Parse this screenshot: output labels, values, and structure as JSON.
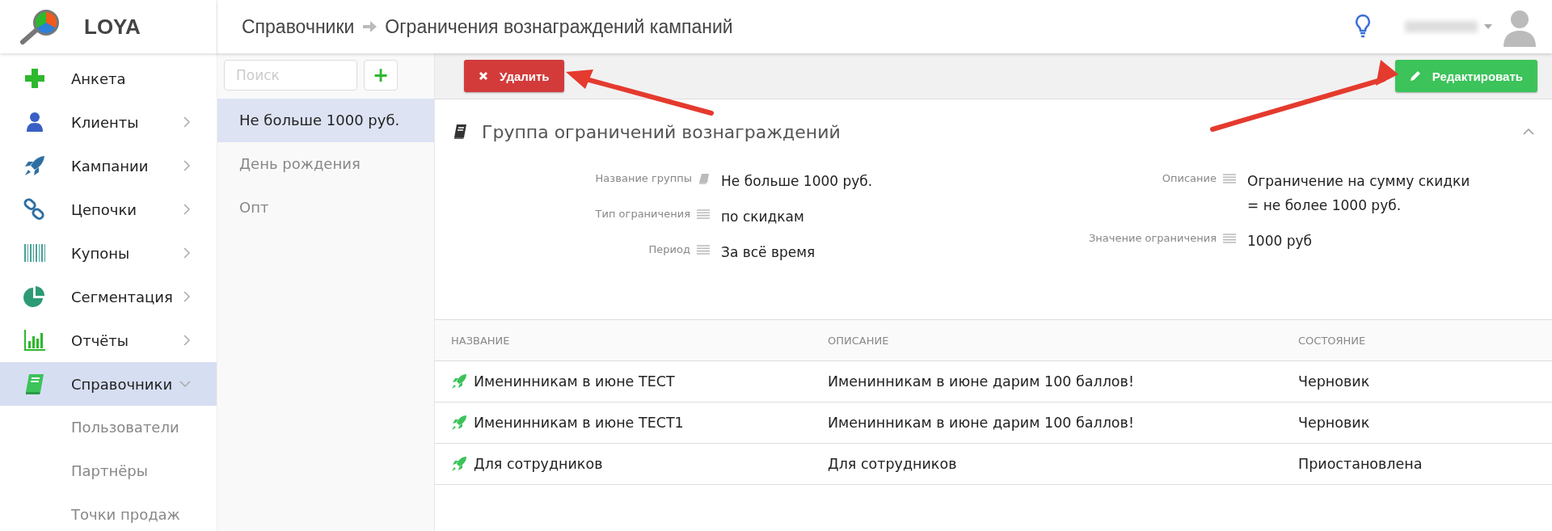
{
  "brand": {
    "name": "LOYA"
  },
  "breadcrumb": {
    "parent": "Справочники",
    "current": "Ограничения вознаграждений кампаний"
  },
  "sidebar": {
    "items": [
      {
        "label": "Анкета",
        "kind": "plus",
        "selected": false
      },
      {
        "label": "Клиенты",
        "kind": "user",
        "selected": false,
        "expanded": false
      },
      {
        "label": "Кампании",
        "kind": "rocket",
        "selected": false,
        "expanded": false
      },
      {
        "label": "Цепочки",
        "kind": "chain",
        "selected": false,
        "expanded": false
      },
      {
        "label": "Купоны",
        "kind": "barcode",
        "selected": false,
        "expanded": false
      },
      {
        "label": "Сегментация",
        "kind": "pie",
        "selected": false,
        "expanded": false
      },
      {
        "label": "Отчёты",
        "kind": "bars",
        "selected": false,
        "expanded": false
      },
      {
        "label": "Справочники",
        "kind": "book",
        "selected": true,
        "expanded": true,
        "children": [
          {
            "label": "Пользователи",
            "selected": false
          },
          {
            "label": "Партнёры",
            "selected": false
          },
          {
            "label": "Точки продаж",
            "selected": false
          }
        ]
      }
    ]
  },
  "list": {
    "search": {
      "placeholder": "Поиск"
    },
    "add_button": "+",
    "items": [
      {
        "label": "Не больше 1000 руб.",
        "selected": true
      },
      {
        "label": "День рождения",
        "selected": false
      },
      {
        "label": "Опт",
        "selected": false
      }
    ]
  },
  "toolbar": {
    "delete_button": "Удалить",
    "edit_button": "Редактировать"
  },
  "section": {
    "title": "Группа ограничений вознаграждений",
    "expanded": true,
    "fields_left": [
      {
        "label": "Название группы",
        "kind": "title",
        "value": "Не больше 1000 руб."
      },
      {
        "label": "Тип ограничения",
        "kind": "text",
        "value": "по скидкам"
      },
      {
        "label": "Период",
        "kind": "text",
        "value": "За всё время"
      }
    ],
    "fields_right": [
      {
        "label": "Описание",
        "kind": "text",
        "value": "Ограничение на сумму скидки = не более 1000 руб."
      },
      {
        "label": "Значение ограничения",
        "kind": "text",
        "value": "1000 руб"
      }
    ]
  },
  "table": {
    "columns": [
      "НАЗВАНИЕ",
      "ОПИСАНИЕ",
      "СОСТОЯНИЕ"
    ],
    "rows": [
      {
        "name": "Именинникам в июне ТЕСТ",
        "description": "Именинникам в июне дарим 100 баллов!",
        "status": "Черновик"
      },
      {
        "name": "Именинникам в июне ТЕСТ1",
        "description": "Именинникам в июне дарим 100 баллов!",
        "status": "Черновик"
      },
      {
        "name": "Для сотрудников",
        "description": "Для сотрудников",
        "status": "Приостановлена"
      }
    ]
  }
}
